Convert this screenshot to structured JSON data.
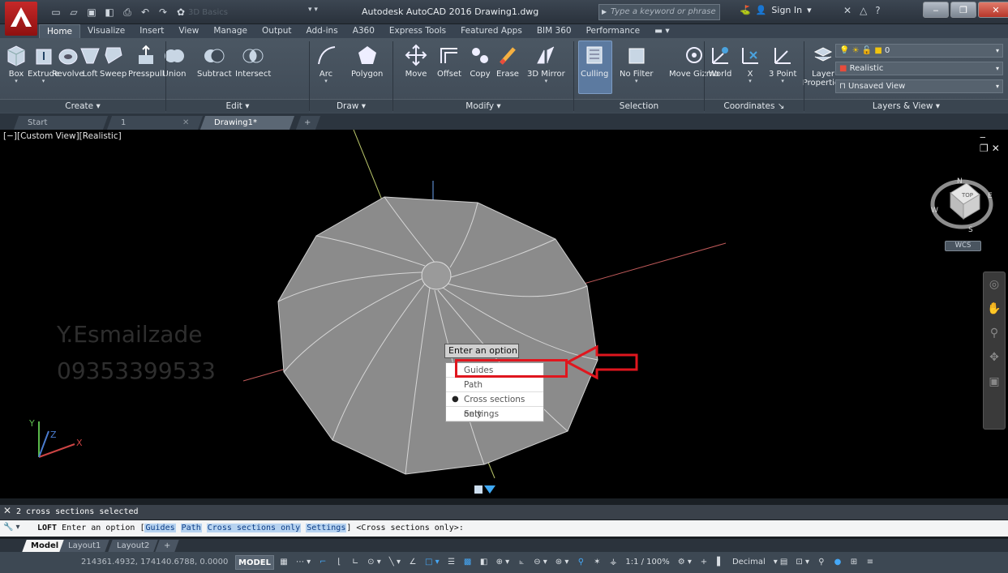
{
  "titlebar": {
    "workspace": "3D Basics",
    "title": "Autodesk AutoCAD 2016   Drawing1.dwg",
    "search_placeholder": "Type a keyword or phrase",
    "signin": "Sign In"
  },
  "ribbon_tabs": [
    "Home",
    "Visualize",
    "Insert",
    "View",
    "Manage",
    "Output",
    "Add-ins",
    "A360",
    "Express Tools",
    "Featured Apps",
    "BIM 360",
    "Performance"
  ],
  "ribbon": {
    "buttons": [
      "Box",
      "Extrude",
      "Revolve",
      "Loft",
      "Sweep",
      "Presspull",
      "Union",
      "Subtract",
      "Intersect",
      "Arc",
      "Polygon",
      "Move",
      "Offset",
      "Copy",
      "Erase",
      "3D Mirror",
      "Culling",
      "No Filter",
      "Move Gizmo",
      "World",
      "X",
      "3 Point",
      "Layer Properties"
    ],
    "panels": [
      "Create",
      "Edit",
      "Draw",
      "Modify",
      "Selection",
      "Coordinates",
      "Layers & View"
    ],
    "layer_rows": [
      "0",
      "Realistic",
      "Unsaved View"
    ]
  },
  "doc_tabs": [
    "Start",
    "1",
    "Drawing1*"
  ],
  "viewport": {
    "label": "[−][Custom View][Realistic]",
    "watermark_name": "Y.Esmailzade",
    "watermark_phone": "09353399533",
    "wcs": "WCS",
    "viewcube": {
      "top": "TOP",
      "n": "N",
      "e": "E",
      "s": "S",
      "w": "W"
    }
  },
  "context": {
    "prompt": "Enter an option",
    "items": [
      "Guides",
      "Path",
      "Cross sections only",
      "Settings"
    ],
    "selected": "Cross sections only"
  },
  "command": {
    "history": "2 cross sections selected",
    "cmd": "LOFT",
    "prompt_start": "Enter an option [",
    "options": [
      "Guides",
      "Path",
      "Cross sections only",
      "Settings"
    ],
    "prompt_end": "] <Cross sections only>:"
  },
  "layout_tabs": [
    "Model",
    "Layout1",
    "Layout2"
  ],
  "status": {
    "coords": "214361.4932, 174140.6788, 0.0000",
    "model": "MODEL",
    "scale": "1:1 / 100%",
    "units": "Decimal"
  },
  "colors": {
    "accent": "#e0161e",
    "ribbon": "#4b5763",
    "viewport": "#000000"
  }
}
